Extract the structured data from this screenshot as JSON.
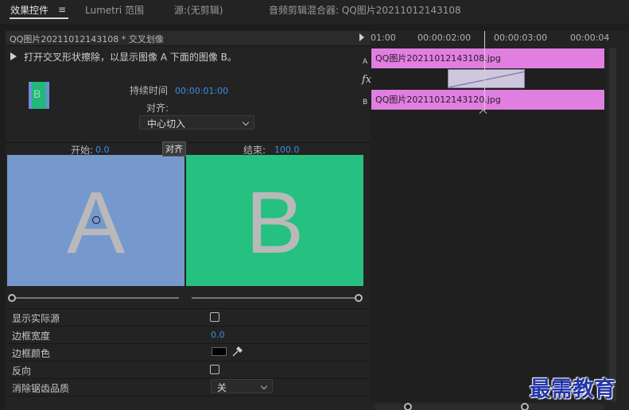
{
  "tabs": [
    {
      "label": "效果控件"
    },
    {
      "label": "Lumetri 范围"
    },
    {
      "label": "源:(无剪辑)"
    },
    {
      "label": "音频剪辑混合器: QQ图片20211012143108"
    }
  ],
  "clip_header": "QQ图片20211012143108 * 交叉划像",
  "description": "打开交叉形状擦除，以显示图像 A 下面的图像 B。",
  "thumbnail_letter": "B",
  "duration": {
    "label": "持续时间",
    "value": "00:00:01:00"
  },
  "alignment": {
    "label": "对齐:",
    "selected": "中心切入"
  },
  "start": {
    "label": "开始:",
    "value": "0.0"
  },
  "end": {
    "label": "结束:",
    "value": "100.0"
  },
  "tooltip": "对齐",
  "preview_a_letter": "A",
  "preview_b_letter": "B",
  "properties": {
    "show_actual_sources": "显示实际源",
    "border_width": "边框宽度",
    "border_width_value": "0.0",
    "border_color": "边框颜色",
    "reverse": "反向",
    "anti_aliasing": "消除锯齿品质",
    "anti_aliasing_value": "关"
  },
  "timeline": {
    "ticks": [
      "01:00",
      "00:00:02:00",
      "00:00:03:00",
      "00:00:04"
    ],
    "track_a_label": "A",
    "track_b_label": "B",
    "clip_a": "QQ图片20211012143108.jpg",
    "clip_b": "QQ图片20211012143120.jpg",
    "fx_label": "fx"
  },
  "watermark": "最需教育",
  "colors": {
    "accent_blue": "#3b8ee8",
    "clip_pink": "#e07fe0",
    "preview_a": "#7698cc",
    "preview_b": "#26c080"
  }
}
